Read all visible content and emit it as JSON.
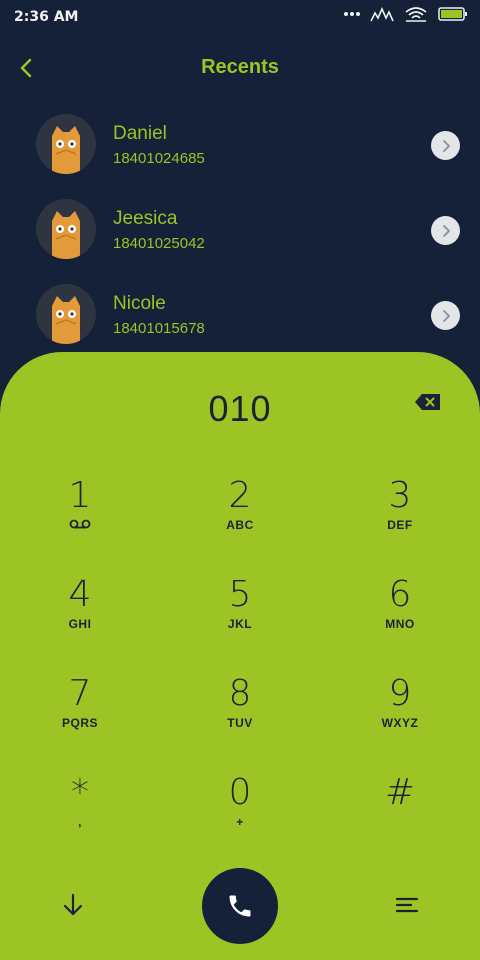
{
  "status_bar": {
    "time": "2:36 AM"
  },
  "header": {
    "title": "Recents"
  },
  "recents": [
    {
      "name": "Daniel",
      "number": "18401024685"
    },
    {
      "name": "Jeesica",
      "number": "18401025042"
    },
    {
      "name": "Nicole",
      "number": "18401015678"
    }
  ],
  "dialpad": {
    "input": "010",
    "keys": [
      {
        "digit": "1",
        "letters": ""
      },
      {
        "digit": "2",
        "letters": "ABC"
      },
      {
        "digit": "3",
        "letters": "DEF"
      },
      {
        "digit": "4",
        "letters": "GHI"
      },
      {
        "digit": "5",
        "letters": "JKL"
      },
      {
        "digit": "6",
        "letters": "MNO"
      },
      {
        "digit": "7",
        "letters": "PQRS"
      },
      {
        "digit": "8",
        "letters": "TUV"
      },
      {
        "digit": "9",
        "letters": "WXYZ"
      },
      {
        "digit": "*",
        "letters": ","
      },
      {
        "digit": "0",
        "letters": "+"
      },
      {
        "digit": "#",
        "letters": ""
      }
    ]
  },
  "colors": {
    "background": "#152039",
    "accent": "#9bc424",
    "avatar_owl": "#e39a3a"
  },
  "icons": [
    "back-icon",
    "signal-icon",
    "wifi-icon",
    "battery-icon",
    "owl-avatar-icon",
    "chevron-right-icon",
    "backspace-icon",
    "voicemail-icon",
    "collapse-icon",
    "phone-icon",
    "menu-icon"
  ]
}
